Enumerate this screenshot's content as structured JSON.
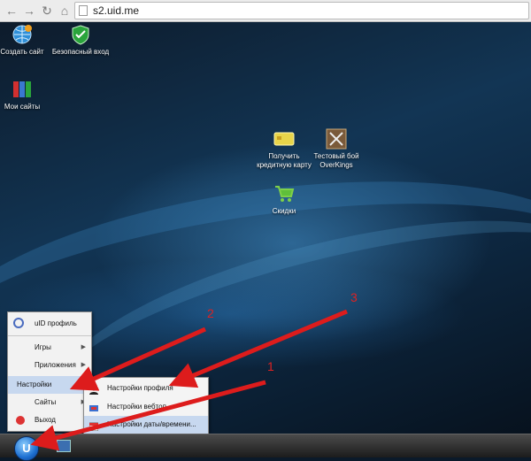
{
  "browser": {
    "url": "s2.uid.me",
    "back_icon": "arrow-left-icon",
    "forward_icon": "arrow-right-icon",
    "reload_icon": "reload-icon",
    "home_icon": "home-icon"
  },
  "desktop": {
    "icons": [
      {
        "label": "Создать сайт",
        "icon": "globe-create-icon"
      },
      {
        "label": "Безопасный вход",
        "icon": "shield-check-icon"
      },
      {
        "label": "Мои сайты",
        "icon": "books-icon"
      },
      {
        "label": "Получить кредитную карту",
        "icon": "credit-card-icon"
      },
      {
        "label": "Тестовый бой OverKings",
        "icon": "crossed-swords-icon"
      },
      {
        "label": "Скидки",
        "icon": "cart-icon"
      }
    ]
  },
  "start_menu": {
    "header": "uID профиль",
    "items": [
      {
        "label": "Игры",
        "has_submenu": true
      },
      {
        "label": "Приложения",
        "has_submenu": true
      },
      {
        "label": "Настройки",
        "has_submenu": true
      },
      {
        "label": "Сайты",
        "has_submenu": true
      },
      {
        "label": "Выход",
        "has_submenu": false
      }
    ],
    "highlighted": "Настройки"
  },
  "submenu": {
    "items": [
      {
        "label": "Настройки профиля",
        "icon": "user-icon"
      },
      {
        "label": "Настройки вебтоп",
        "icon": "desktop-settings-icon"
      },
      {
        "label": "Настройки даты/времени...",
        "icon": "calendar-icon"
      }
    ]
  },
  "annotations": {
    "labels": [
      "1",
      "2",
      "3"
    ],
    "arrow_color": "#dd1c1c"
  },
  "taskbar": {
    "start_label": "U"
  }
}
